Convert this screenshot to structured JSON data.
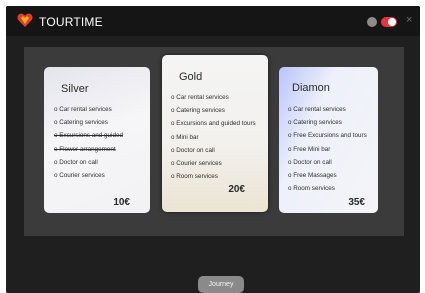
{
  "app": {
    "title": "TOURTIME",
    "close_glyph": "×"
  },
  "toggle": {
    "state": "on",
    "color": "#e9343c"
  },
  "plans": [
    {
      "name": "Silver",
      "features": [
        "o Car rental services",
        "o Catering services",
        "o Excursions and guided",
        "o Flower arrangement",
        "o Doctor on call",
        "o Courier services"
      ],
      "price": "10€"
    },
    {
      "name": "Gold",
      "features": [
        "o Car rental services",
        "o Catering services",
        "o Excursions and guided tours",
        "o Mini bar",
        "o Doctor on call",
        "o Courier services",
        "o Room services"
      ],
      "price": "20€"
    },
    {
      "name": "Diamon",
      "features": [
        "o Car rental services",
        "o Catering services",
        "o Free Excursions and tours",
        "o Free Mini bar",
        "o Doctor on call",
        "o Free Massages",
        "o Room services"
      ],
      "price": "35€"
    }
  ],
  "journey_button": {
    "label": "Journey"
  },
  "colors": {
    "background": "#1f1f1f",
    "titlebar": "#151515",
    "panel": "#3b3b3b",
    "accent": "#e9343c"
  },
  "icons": {
    "logo": "heart-shield-logo",
    "settings": "globe-icon",
    "toggle": "toggle-switch",
    "close": "close-icon"
  }
}
